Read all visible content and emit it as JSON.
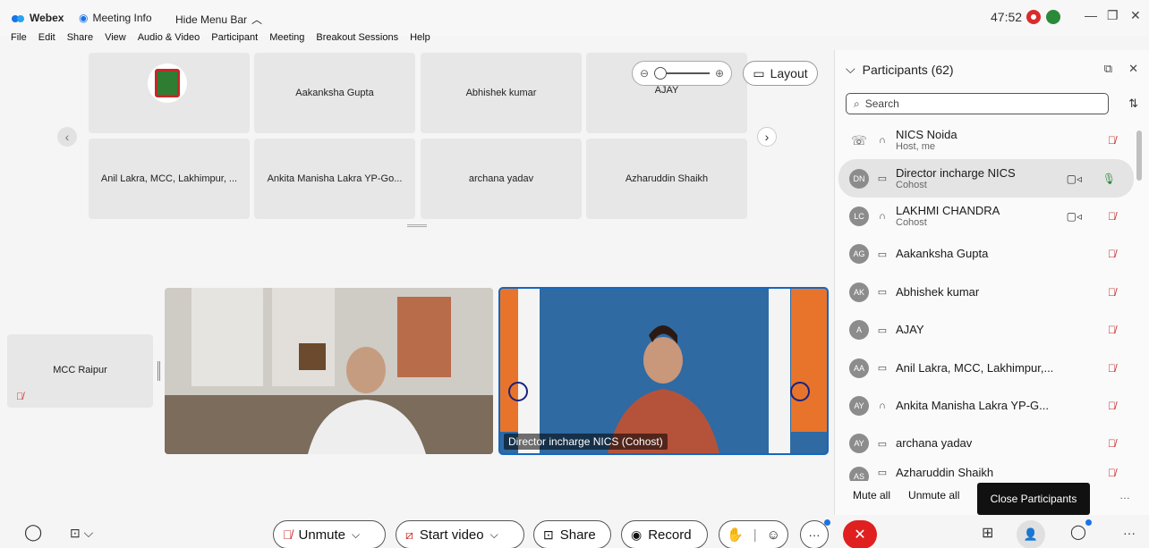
{
  "titlebar": {
    "app": "Webex",
    "meeting_info": "Meeting Info",
    "hide_menu": "Hide Menu Bar",
    "timer": "47:52"
  },
  "menu": [
    {
      "label": "File"
    },
    {
      "label": "Edit"
    },
    {
      "label": "Share"
    },
    {
      "label": "View"
    },
    {
      "label": "Audio & Video"
    },
    {
      "label": "Participant"
    },
    {
      "label": "Meeting"
    },
    {
      "label": "Breakout Sessions"
    },
    {
      "label": "Help"
    }
  ],
  "grid": {
    "tiles": [
      {
        "label": ""
      },
      {
        "label": "Aakanksha Gupta"
      },
      {
        "label": "Abhishek kumar"
      },
      {
        "label": "AJAY"
      },
      {
        "label": "Anil Lakra, MCC, Lakhimpur, ..."
      },
      {
        "label": "Ankita Manisha Lakra YP-Go..."
      },
      {
        "label": "archana yadav"
      },
      {
        "label": "Azharuddin Shaikh"
      }
    ],
    "layout_label": "Layout"
  },
  "stage": {
    "mcc_label": "MCC Raipur",
    "video2_label": "Director incharge NICS (Cohost)"
  },
  "participants": {
    "title": "Participants (62)",
    "search_placeholder": "Search",
    "rows": [
      {
        "initials": "",
        "name": "NICS Noida",
        "role": "Host, me",
        "cam": false,
        "mic": "muted"
      },
      {
        "initials": "DN",
        "name": "Director incharge NICS",
        "role": "Cohost",
        "cam": true,
        "mic": "on"
      },
      {
        "initials": "LC",
        "name": "LAKHMI CHANDRA",
        "role": "Cohost",
        "cam": true,
        "mic": "muted"
      },
      {
        "initials": "AG",
        "name": "Aakanksha Gupta",
        "role": "",
        "cam": false,
        "mic": "muted-lock"
      },
      {
        "initials": "AK",
        "name": "Abhishek kumar",
        "role": "",
        "cam": false,
        "mic": "muted-lock"
      },
      {
        "initials": "A",
        "name": "AJAY",
        "role": "",
        "cam": false,
        "mic": "muted-lock"
      },
      {
        "initials": "AA",
        "name": "Anil Lakra, MCC, Lakhimpur,...",
        "role": "",
        "cam": false,
        "mic": "muted-lock"
      },
      {
        "initials": "AY",
        "name": "Ankita Manisha Lakra YP-G...",
        "role": "",
        "cam": false,
        "mic": "muted-lock"
      },
      {
        "initials": "AY",
        "name": "archana yadav",
        "role": "",
        "cam": false,
        "mic": "muted-lock"
      },
      {
        "initials": "AS",
        "name": "Azharuddin Shaikh",
        "role": "",
        "cam": false,
        "mic": "muted-lock"
      }
    ],
    "mute_all": "Mute all",
    "unmute_all": "Unmute all",
    "tooltip": "Close Participants"
  },
  "controls": {
    "unmute": "Unmute",
    "start_video": "Start video",
    "share": "Share",
    "record": "Record"
  },
  "colors": {
    "end_call": "#e02020",
    "accent_blue": "#1566c0",
    "muted_red": "#c62828"
  }
}
